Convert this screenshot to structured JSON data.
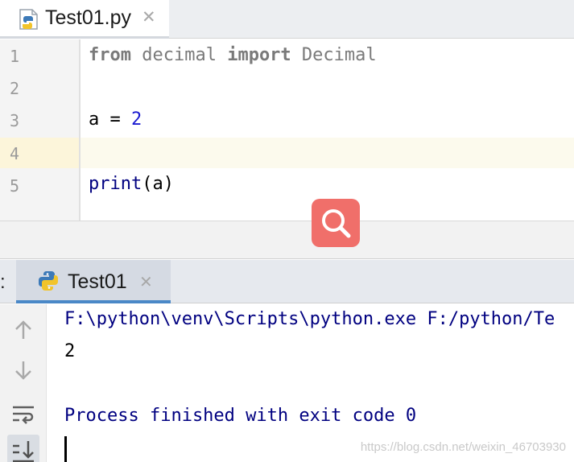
{
  "editor": {
    "tab": {
      "label": "Test01.py",
      "icon": "python-file-icon",
      "close_icon": "close-icon"
    },
    "lines": [
      {
        "number": "1",
        "tokens": [
          {
            "t": "from",
            "c": "kw"
          },
          {
            "t": " decimal ",
            "c": "dim"
          },
          {
            "t": "import",
            "c": "kw"
          },
          {
            "t": " Decimal",
            "c": "dim"
          }
        ]
      },
      {
        "number": "2",
        "tokens": []
      },
      {
        "number": "3",
        "tokens": [
          {
            "t": "a = ",
            "c": ""
          },
          {
            "t": "2",
            "c": "num"
          }
        ]
      },
      {
        "number": "4",
        "tokens": []
      },
      {
        "number": "5",
        "tokens": [
          {
            "t": "print",
            "c": "builtin"
          },
          {
            "t": "(a)",
            "c": ""
          }
        ]
      }
    ],
    "current_line": "4"
  },
  "overlay": {
    "icon": "search-icon",
    "color": "#f06f6a"
  },
  "run_window": {
    "prefix": ":",
    "tab": {
      "label": "Test01",
      "icon": "python-icon",
      "close_icon": "close-icon"
    },
    "toolbar": [
      {
        "name": "rerun-up-icon"
      },
      {
        "name": "arrow-down-icon"
      },
      {
        "name": "soft-wrap-icon"
      },
      {
        "name": "scroll-to-end-icon"
      }
    ],
    "console": {
      "command": "F:\\python\\venv\\Scripts\\python.exe F:/python/Te",
      "output": "2",
      "exit_message": "Process finished with exit code 0"
    }
  },
  "watermark": "https://blog.csdn.net/weixin_46703930",
  "colors": {
    "accent": "#4a88c7",
    "keyword": "#7a7a7a",
    "number": "#1a1ad0",
    "console_text": "#000080"
  }
}
